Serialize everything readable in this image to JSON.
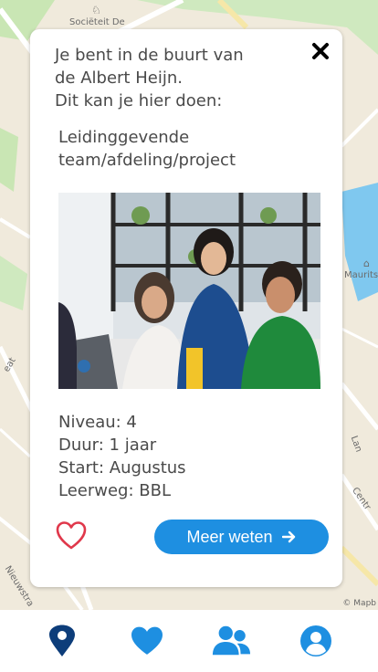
{
  "map": {
    "labels": {
      "societeit": "Sociëteit De",
      "maurits": "Maurits",
      "laan": "Lan",
      "centrum": "Centr",
      "nieuwstraat": "Nieuwstra",
      "straat": "eat"
    },
    "credit": "© Mapb"
  },
  "card": {
    "intro_line1": "Je bent in de buurt van",
    "intro_line2": "de Albert Heijn.",
    "intro_line3": "Dit kan je hier doen:",
    "job_title_line1": "Leidinggevende",
    "job_title_line2": "team/afdeling/project",
    "details": {
      "niveau": "Niveau: 4",
      "duur": "Duur: 1 jaar",
      "start": "Start: Augustus",
      "leerweg": "Leerweg: BBL"
    },
    "more_button_label": "Meer weten"
  },
  "colors": {
    "accent": "#1e8fe1",
    "nav_dark": "#0d3d7a",
    "heart": "#e0384b"
  },
  "nav": {
    "items": [
      "map-pin-icon",
      "heart-icon",
      "users-icon",
      "profile-icon"
    ]
  }
}
